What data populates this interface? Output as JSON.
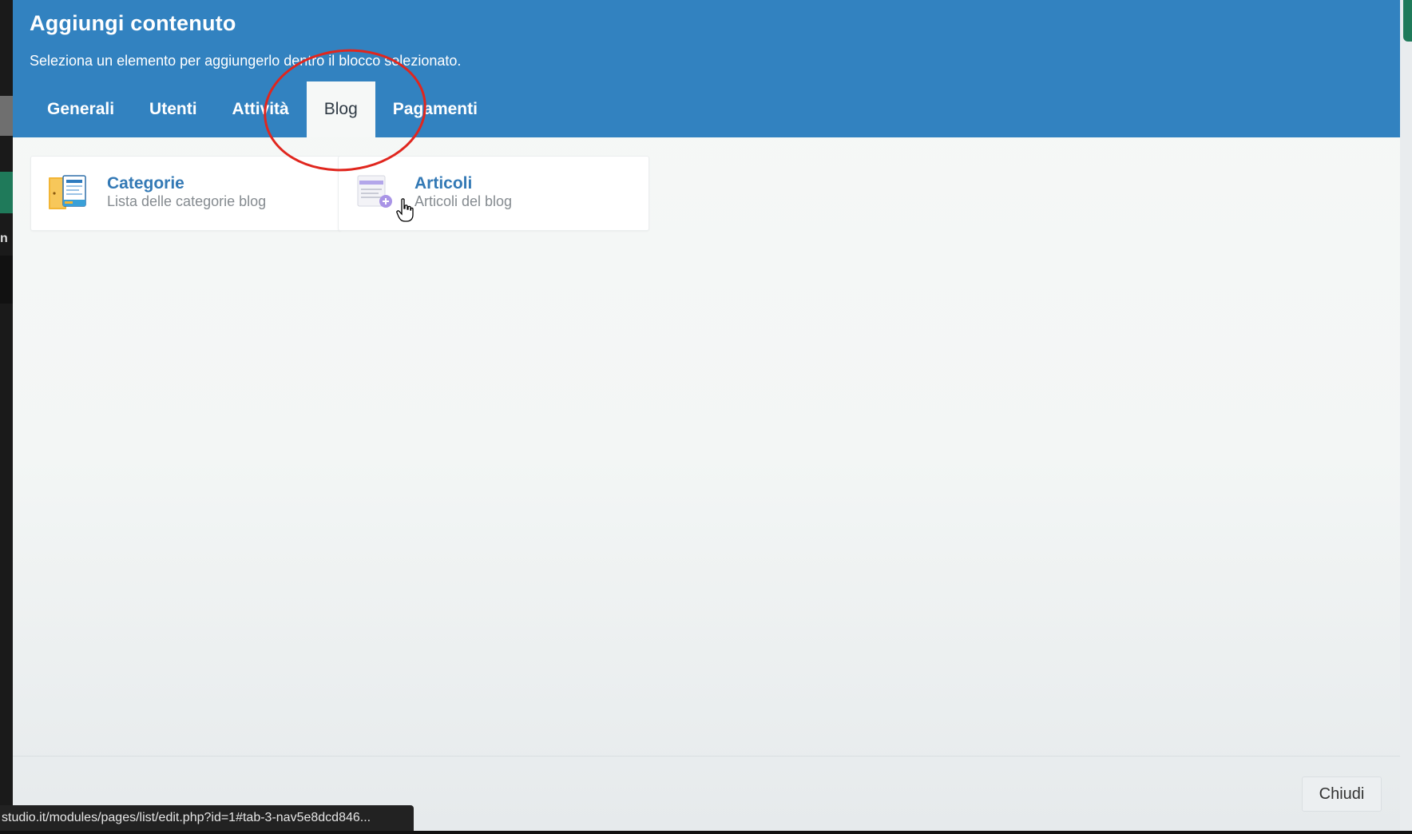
{
  "modal": {
    "title": "Aggiungi contenuto",
    "subtitle": "Seleziona un elemento per aggiungerlo dentro il blocco selezionato.",
    "tabs": [
      {
        "label": "Generali"
      },
      {
        "label": "Utenti"
      },
      {
        "label": "Attività"
      },
      {
        "label": "Blog",
        "active": true
      },
      {
        "label": "Pagamenti"
      }
    ],
    "cards": [
      {
        "title": "Categorie",
        "description": "Lista delle categorie blog",
        "icon": "folder-book-icon"
      },
      {
        "title": "Articoli",
        "description": "Articoli del blog",
        "icon": "article-add-icon"
      }
    ],
    "close_label": "Chiudi"
  },
  "status_bar": {
    "url": "studio.it/modules/pages/list/edit.php?id=1#tab-3-nav5e8dcd846..."
  },
  "backdrop": {
    "left_partial_text": "n"
  },
  "colors": {
    "header": "#3282c0",
    "title_link": "#3379b5",
    "highlight_circle": "#e0261e"
  }
}
